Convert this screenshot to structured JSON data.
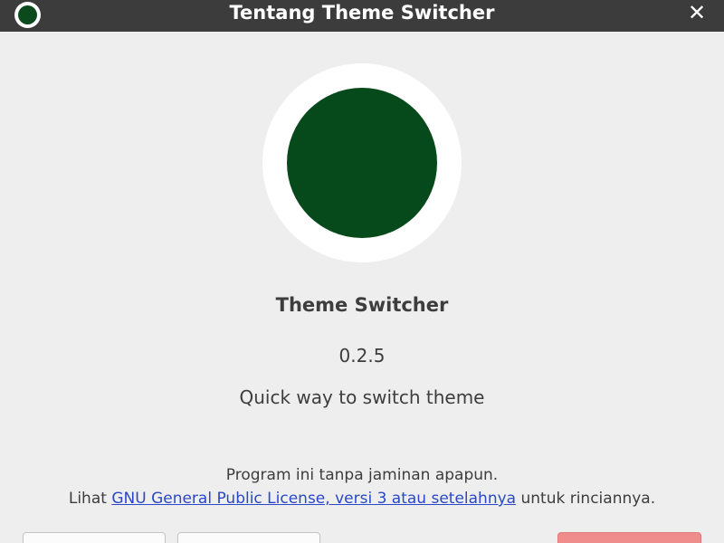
{
  "window": {
    "title": "Tentang Theme Switcher",
    "close_glyph": "✕"
  },
  "about": {
    "app_name": "Theme Switcher",
    "version": "0.2.5",
    "description": "Quick way to switch theme",
    "license_line1": "Program ini tanpa jaminan apapun.",
    "license_prefix": "Lihat ",
    "license_link": "GNU General Public License, versi 3 atau setelahnya",
    "license_suffix": " untuk rinciannya."
  },
  "colors": {
    "titlebar": "#3c3c3c",
    "logo_green": "#064a1c",
    "link": "#2a48c8",
    "destructive_button": "#ef8c8c"
  },
  "icons": {
    "app_icon": "app-logo-icon",
    "close": "close-icon"
  }
}
